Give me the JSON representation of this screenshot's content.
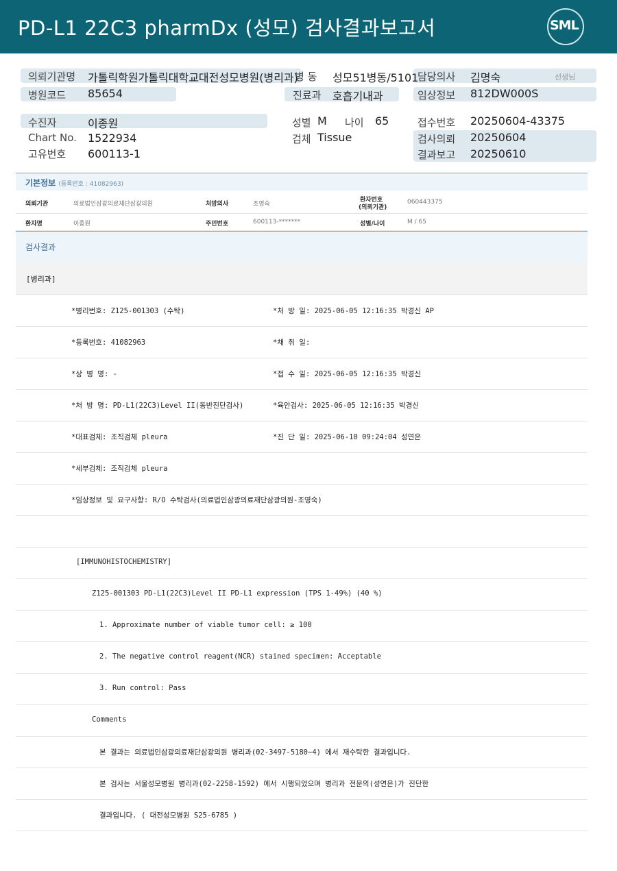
{
  "header": {
    "title": "PD-L1 22C3 pharmDx (성모) 검사결과보고서",
    "logo_text": "SML"
  },
  "summary": {
    "institution_label": "의뢰기관명",
    "institution_value": "가톨릭학원가톨릭대학교대전성모병원(병리과)",
    "ward_label": "병 동",
    "ward_value": "성모51병동/5101",
    "doctor_label": "담당의사",
    "doctor_value": "김명숙",
    "doctor_suffix": "선생님",
    "hospital_code_label": "병원코드",
    "hospital_code_value": "85654",
    "department_label": "진료과",
    "department_value": "호흡기내과",
    "clinical_label": "임상정보",
    "clinical_value": "812DW000S",
    "patient_label": "수진자",
    "patient_value": "이종원",
    "sex_label": "성별",
    "sex_value": "M",
    "age_label": "나이",
    "age_value": "65",
    "receipt_label": "접수번호",
    "receipt_value": "20250604-43375",
    "chart_label": "Chart No.",
    "chart_value": "1522934",
    "specimen_label": "검체",
    "specimen_value": "Tissue",
    "request_label": "검사의뢰",
    "request_value": "20250604",
    "unique_label": "고유번호",
    "unique_value": "600113-1",
    "report_label": "결과보고",
    "report_value": "20250610"
  },
  "basic_info": {
    "title": "기본정보",
    "reg_no": "(등록번호 : 41082963)",
    "row1": {
      "institution_label": "의뢰기관",
      "institution_value": "의료법인삼광의료재단삼광의원",
      "prescriber_label": "처방의사",
      "prescriber_value": "조영숙",
      "patient_no_label_1": "환자번호",
      "patient_no_label_2": "(의뢰기관)",
      "patient_no_value": "060443375"
    },
    "row2": {
      "name_label": "환자명",
      "name_value": "이종원",
      "rrn_label": "주민번호",
      "rrn_value": "600113-*******",
      "sexage_label": "성별/나이",
      "sexage_value": "M / 65"
    }
  },
  "results": {
    "title": "검사결과",
    "dept": "[병리과]",
    "rows": [
      {
        "left": "*병리번호: Z125-001303 (수탁)",
        "right": "*처 방 일: 2025-06-05 12:16:35  박경신 AP"
      },
      {
        "left": "*등록번호: 41082963",
        "right": "*채 취 일:"
      },
      {
        "left": "*상 병 명: -",
        "right": "*접 수 일: 2025-06-05 12:16:35  박경신"
      },
      {
        "left": "*처 방 명: PD-L1(22C3)Level II(동반진단검사)",
        "right": "*육안검사: 2025-06-05 12:16:35  박경신"
      },
      {
        "left": "*대표검체: 조직검체 pleura",
        "right": "*진 단 일: 2025-06-10 09:24:04  성연은"
      },
      {
        "left": "*세부검체: 조직검체 pleura",
        "right": ""
      },
      {
        "left": "*임상정보 및 요구사항: R/O 수탁검사(의료법인삼광의료재단삼광의원-조영숙)",
        "right": ""
      },
      {
        "left": "",
        "right": ""
      },
      {
        "left": "[IMMUNOHISTOCHEMISTRY]",
        "right": ""
      },
      {
        "left": "Z125-001303      PD-L1(22C3)Level II       PD-L1 expression (TPS 1-49%) (40 %)",
        "right": ""
      },
      {
        "left": "1. Approximate number of viable tumor cell: ≥ 100",
        "right": ""
      },
      {
        "left": "2. The negative control reagent(NCR) stained specimen: Acceptable",
        "right": ""
      },
      {
        "left": "3. Run control: Pass",
        "right": ""
      },
      {
        "left": "Comments",
        "right": ""
      },
      {
        "left": "본 결과는 의료법인삼광의료재단삼광의원 병리과(02-3497-5180~4) 에서 재수탁한 결과입니다.",
        "right": ""
      },
      {
        "left": "본 검사는 서울성모병원 병리과(02-2258-1592) 에서 시행되었으며 병리과 전문의(성연은)가 진단한",
        "right": ""
      },
      {
        "left": "결과입니다. ( 대전성모병원 S25-6785 )",
        "right": ""
      }
    ]
  }
}
